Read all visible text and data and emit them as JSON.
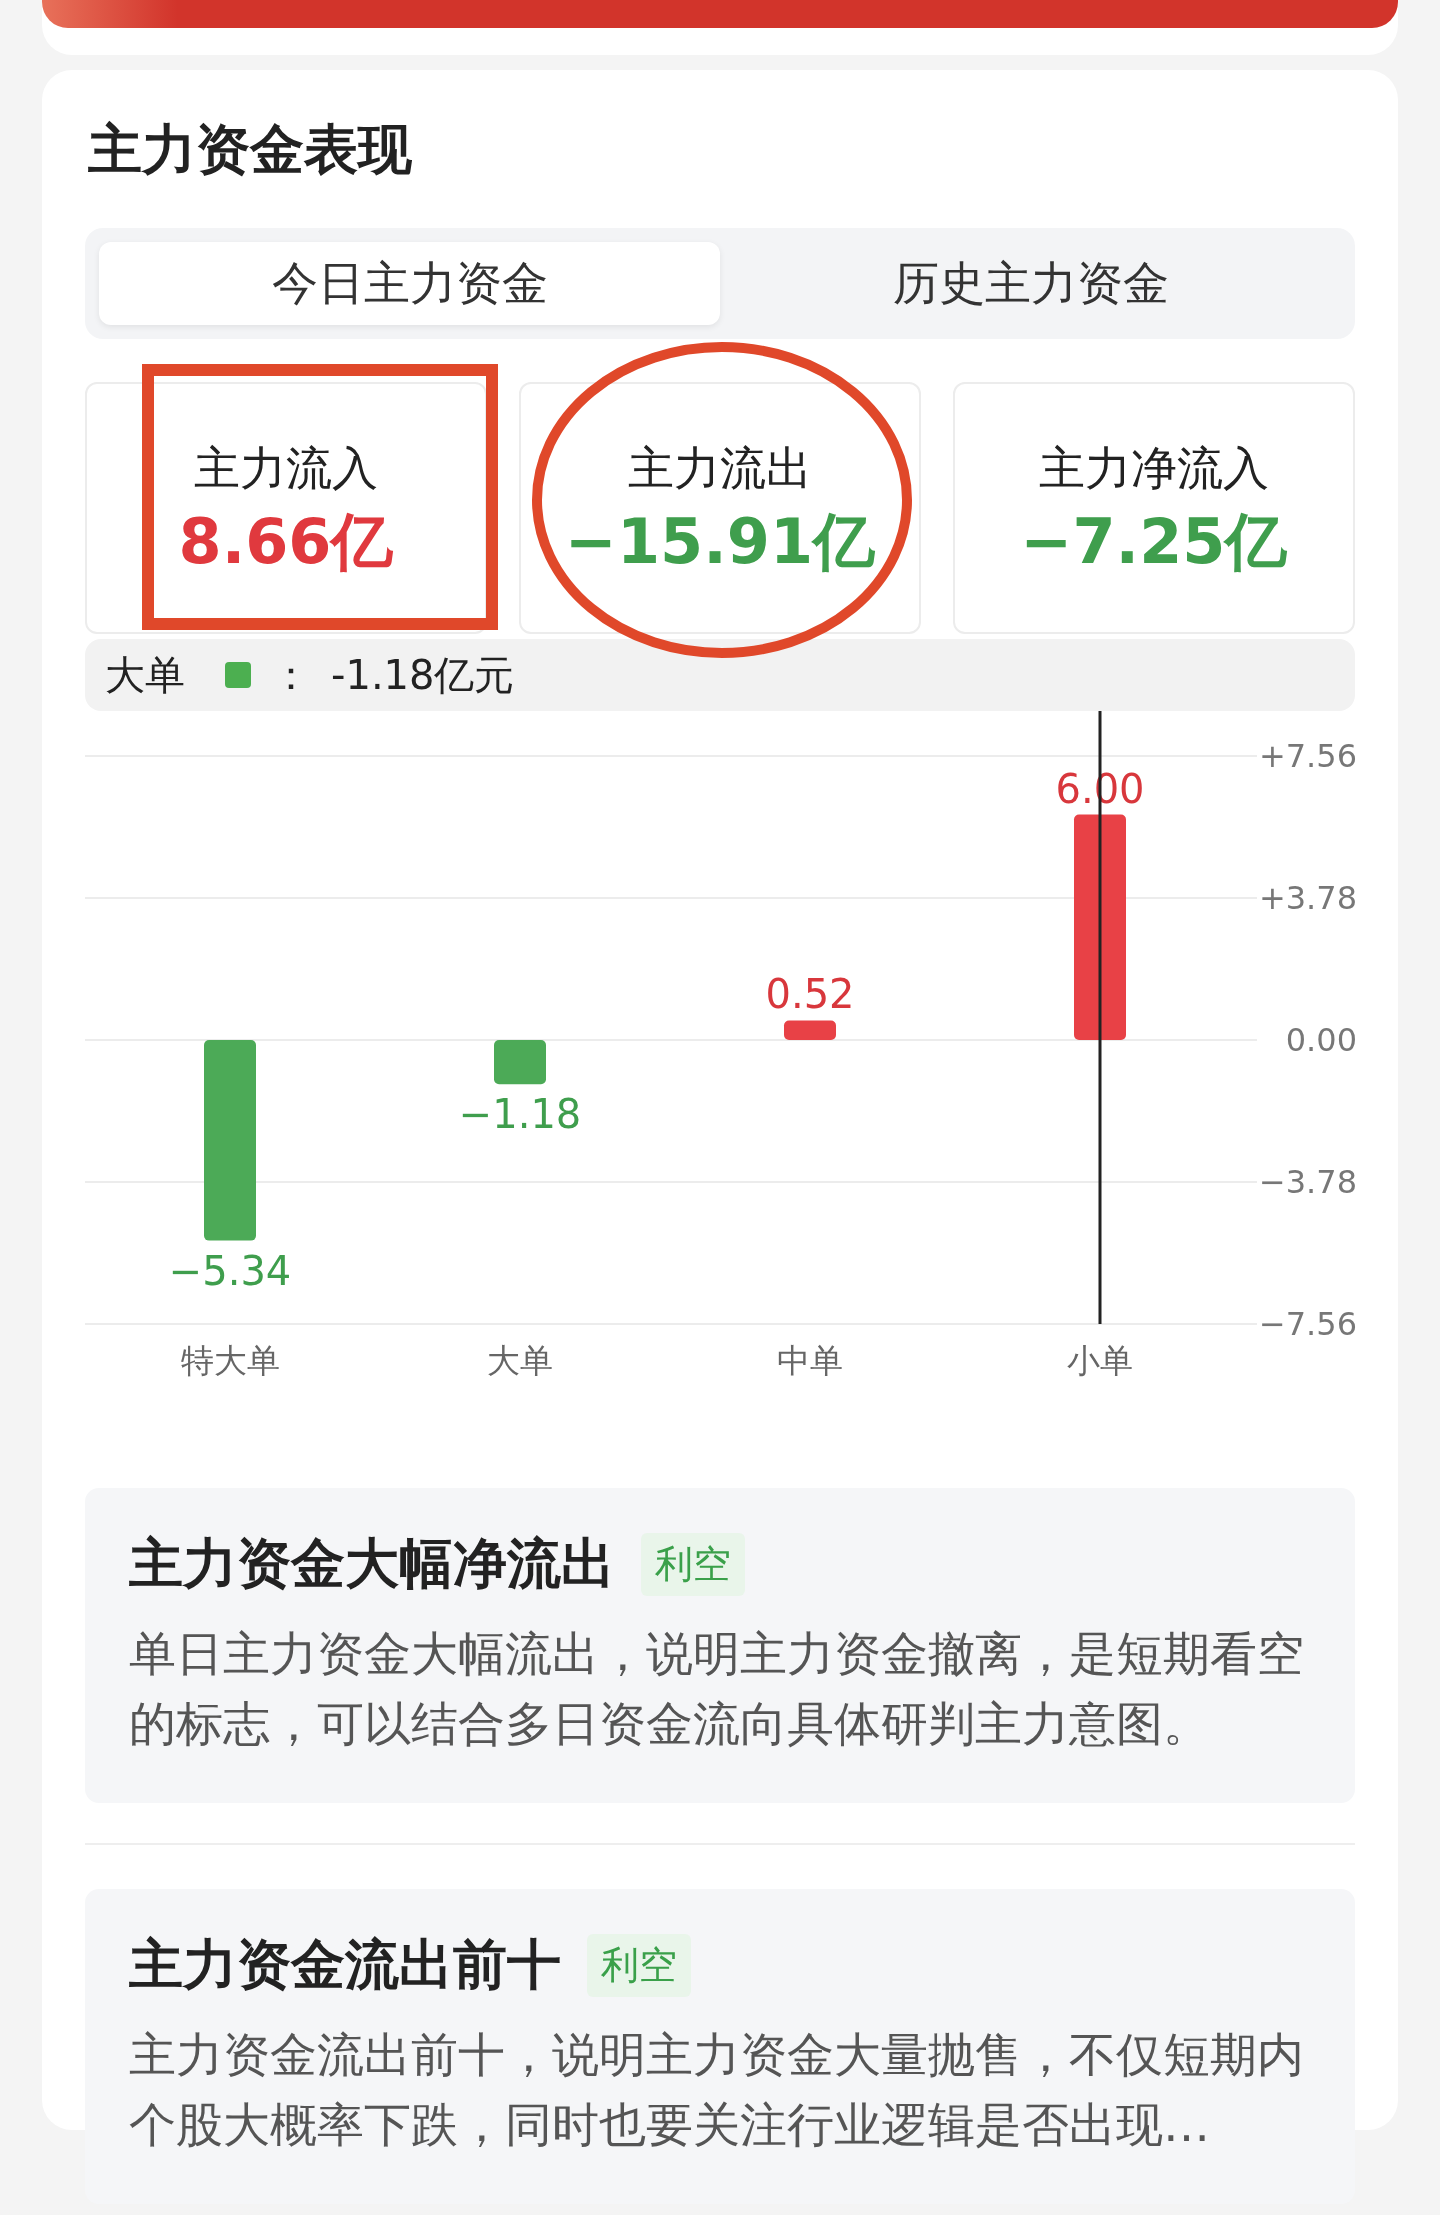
{
  "title": "主力资金表现",
  "tabs": [
    {
      "label": "今日主力资金",
      "selected": true
    },
    {
      "label": "历史主力资金",
      "selected": false
    }
  ],
  "stats": [
    {
      "label": "主力流入",
      "value": "8.66亿",
      "color": "#e0393e",
      "kind": "boxed"
    },
    {
      "label": "主力流出",
      "value": "−15.91亿",
      "color": "#3f9e4d",
      "kind": "circled"
    },
    {
      "label": "主力净流入",
      "value": "−7.25亿",
      "color": "#3f9e4d",
      "kind": "plain"
    }
  ],
  "tooltip": {
    "label": "大单",
    "color": "#4caf50",
    "separator": "：",
    "value": "-1.18亿元"
  },
  "chart_data": {
    "type": "bar",
    "categories": [
      "特大单",
      "大单",
      "中单",
      "小单"
    ],
    "values": [
      -5.34,
      -1.18,
      0.52,
      6.0
    ],
    "ylim": [
      -7.56,
      7.56
    ],
    "yticks": [
      {
        "value": 7.56,
        "label": "+7.56"
      },
      {
        "value": 3.78,
        "label": "+3.78"
      },
      {
        "value": 0,
        "label": "0.00"
      },
      {
        "value": -3.78,
        "label": "−3.78"
      },
      {
        "value": -7.56,
        "label": "−7.56"
      }
    ],
    "value_labels": [
      "−5.34",
      "−1.18",
      "0.52",
      "6.00"
    ],
    "grid": true,
    "ref_lines": [
      {
        "axis": "x",
        "value": "小单"
      }
    ]
  },
  "insights": [
    {
      "title": "主力资金大幅净流出",
      "tag": "利空",
      "text": "单日主力资金大幅流出，说明主力资金撤离，是短期看空的标志，可以结合多日资金流向具体研判主力意图。"
    },
    {
      "title": "主力资金流出前十",
      "tag": "利空",
      "text": "主力资金流出前十，说明主力资金大量抛售，不仅短期内个股大概率下跌，同时也要关注行业逻辑是否出现…"
    }
  ]
}
